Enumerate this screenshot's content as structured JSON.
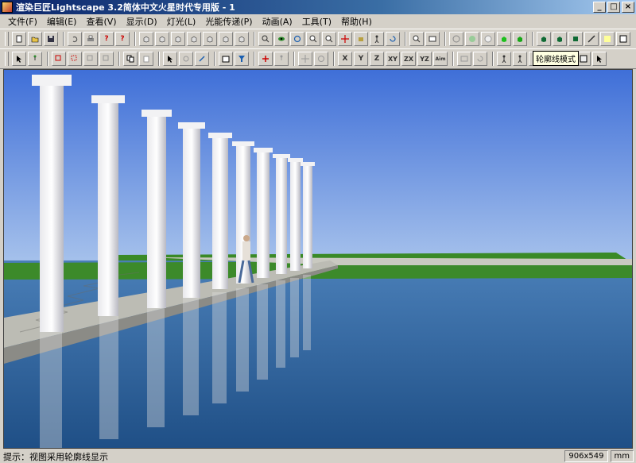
{
  "window": {
    "title": "渲染巨匠Lightscape 3.2简体中文火星时代专用版 - 1",
    "controls": [
      "_",
      "□",
      "×"
    ]
  },
  "menu": [
    {
      "label": "文件(F)"
    },
    {
      "label": "编辑(E)"
    },
    {
      "label": "查看(V)"
    },
    {
      "label": "显示(D)"
    },
    {
      "label": "灯光(L)"
    },
    {
      "label": "光能传递(P)"
    },
    {
      "label": "动画(A)"
    },
    {
      "label": "工具(T)"
    },
    {
      "label": "帮助(H)"
    }
  ],
  "toolbar2_axis_labels": {
    "x": "X",
    "y": "Y",
    "z": "Z",
    "xy": "XY",
    "zx": "ZX",
    "yz": "YZ",
    "aim": "Aim"
  },
  "tooltip": "轮廓线模式",
  "status": {
    "hint": "提示：视图采用轮廓线显示",
    "resolution": "906x549",
    "unit": "mm"
  },
  "colors": {
    "sky_top": "#3f6fd8",
    "sky_bottom": "#a9c4ec",
    "water": "#1f4f86",
    "grass": "#3c8a2a",
    "accent_green": "#1ec01e"
  }
}
